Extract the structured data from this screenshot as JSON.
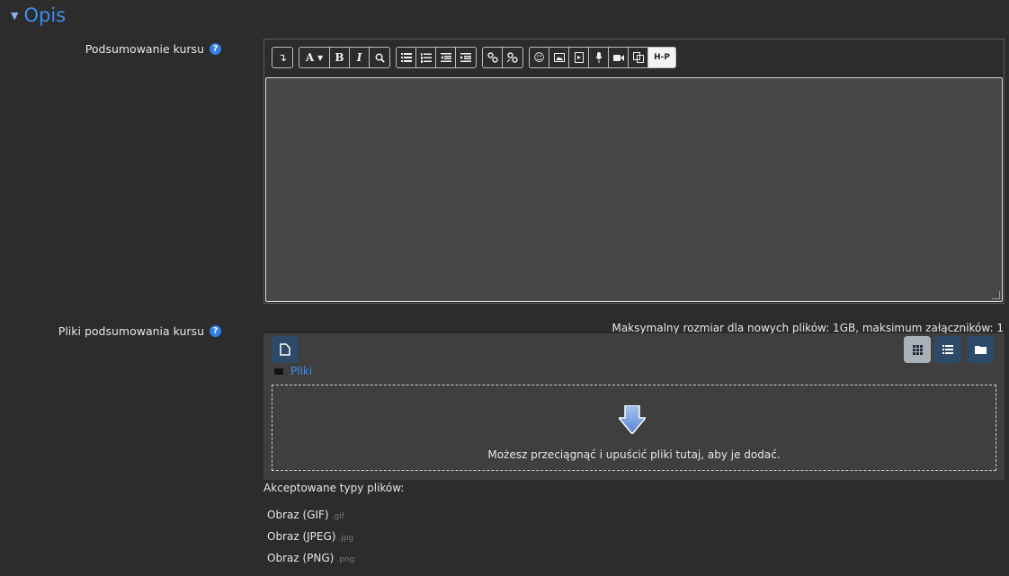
{
  "section": {
    "title": "Opis"
  },
  "summary": {
    "label": "Podsumowanie kursu",
    "help": "?"
  },
  "toolbar": {
    "bold": "B",
    "italic": "I",
    "font": "A",
    "hp": "H-P"
  },
  "files": {
    "label": "Pliki podsumowania kursu",
    "help": "?",
    "max_size": "Maksymalny rozmiar dla nowych plików: 1GB, maksimum załączników: 1",
    "path": "Pliki",
    "drop_text": "Możesz przeciągnąć i upuścić pliki tutaj, aby je dodać.",
    "accepted_label": "Akceptowane typy plików:",
    "types": [
      {
        "name": "Obraz (GIF)",
        "ext": ".gif"
      },
      {
        "name": "Obraz (JPEG)",
        "ext": ".jpg"
      },
      {
        "name": "Obraz (PNG)",
        "ext": ".png"
      }
    ]
  },
  "colors": {
    "accent": "#3d8eef",
    "background": "#2c2c2c",
    "editor": "#474747",
    "button": "#2e4a6a"
  }
}
